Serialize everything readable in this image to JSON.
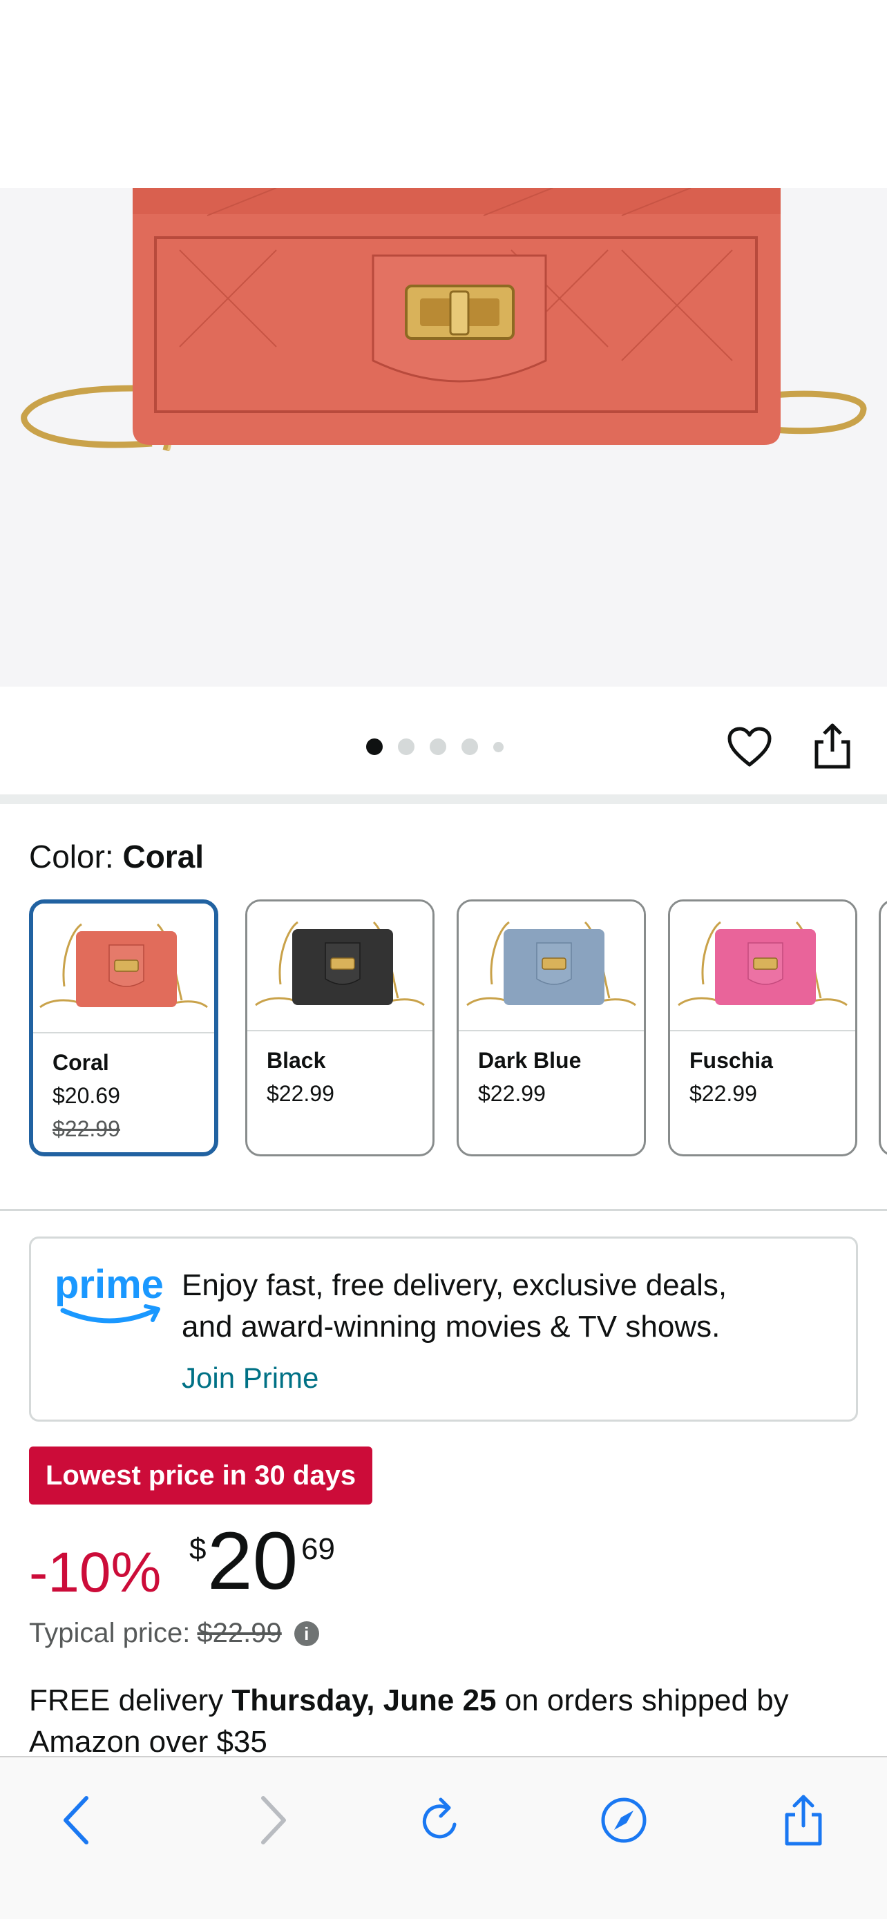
{
  "gallery": {
    "dots": [
      true,
      false,
      false,
      false,
      false
    ]
  },
  "color": {
    "label": "Color: ",
    "selected": "Coral"
  },
  "swatches": [
    {
      "name": "Coral",
      "price": "$20.69",
      "old_price": "$22.99",
      "color": "#e16c5b",
      "selected": true
    },
    {
      "name": "Black",
      "price": "$22.99",
      "old_price": "",
      "color": "#333333",
      "selected": false
    },
    {
      "name": "Dark Blue",
      "price": "$22.99",
      "old_price": "",
      "color": "#8aa3bf",
      "selected": false
    },
    {
      "name": "Fuschia",
      "price": "$22.99",
      "old_price": "",
      "color": "#e9649a",
      "selected": false
    }
  ],
  "prime": {
    "logo_text": "prime",
    "line1": "Enjoy fast, free delivery, exclusive deals,",
    "line2": "and award-winning movies & TV shows.",
    "link": "Join Prime"
  },
  "badge": "Lowest price in 30 days",
  "price": {
    "discount": "-10%",
    "currency": "$",
    "whole": "20",
    "fraction": "69",
    "typical_label": "Typical price:",
    "typical_value": "$22.99"
  },
  "delivery": {
    "prefix": "FREE delivery ",
    "date": "Thursday, June 25",
    "suffix": " on orders shipped by Amazon over $35"
  },
  "colors": {
    "accent_blue": "#2162a1",
    "deal_red": "#cc0c39",
    "link_teal": "#007185",
    "prime_blue": "#1a98ff"
  },
  "toolbar": {
    "icons": [
      "back-icon",
      "forward-icon",
      "reload-icon",
      "compass-icon",
      "share-icon"
    ]
  }
}
